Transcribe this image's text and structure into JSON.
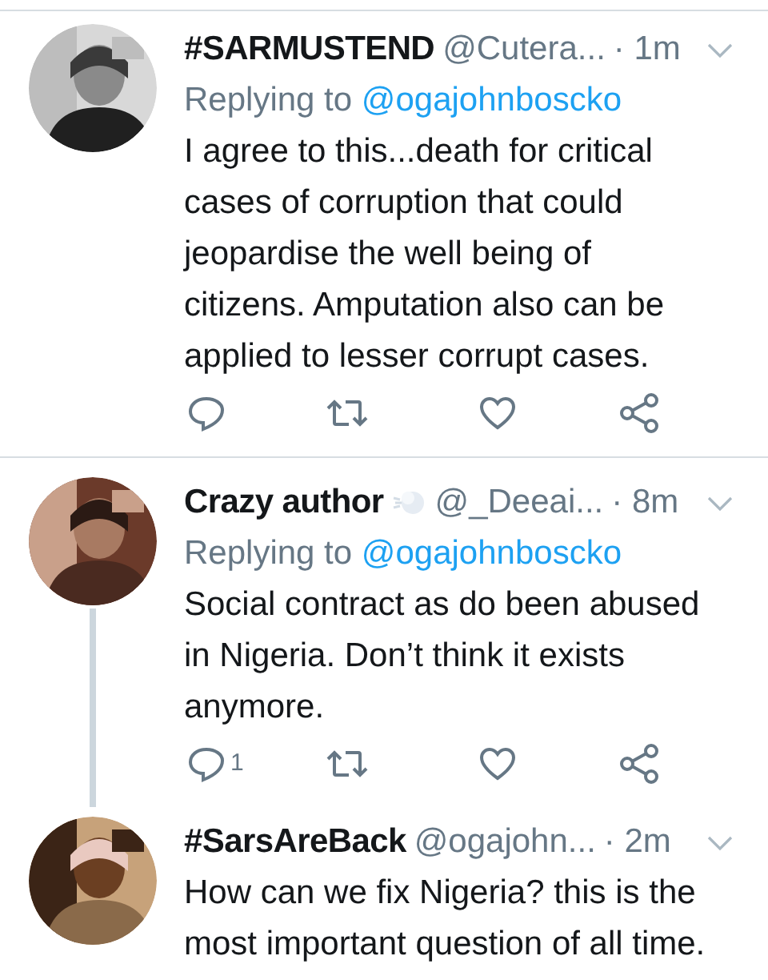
{
  "tweets": [
    {
      "name": "#SARMUSTEND",
      "handle": "@Cutera...",
      "time": "· 1m",
      "replying_label": "Replying to",
      "replying_to": "@ogajohnboscko",
      "body": "I agree to this...death for critical cases of corruption that could jeopardise the well being of citizens. Amputation also can be applied to lesser corrupt cases.",
      "has_actions": true
    },
    {
      "name": "Crazy author",
      "badge": {
        "kind": "puff"
      },
      "handle": "@_Deeai...",
      "time": "· 8m",
      "replying_label": "Replying to",
      "replying_to": "@ogajohnboscko",
      "body": "Social contract as do been abused in Nigeria. Don’t think it exists anymore.",
      "has_actions": true,
      "reply_count": "1",
      "thread_continues": true
    },
    {
      "name": "#SarsAreBack",
      "handle": "@ogajohn...",
      "time": "· 2m",
      "body": "How can we fix Nigeria? this is the most important question of all time."
    }
  ]
}
